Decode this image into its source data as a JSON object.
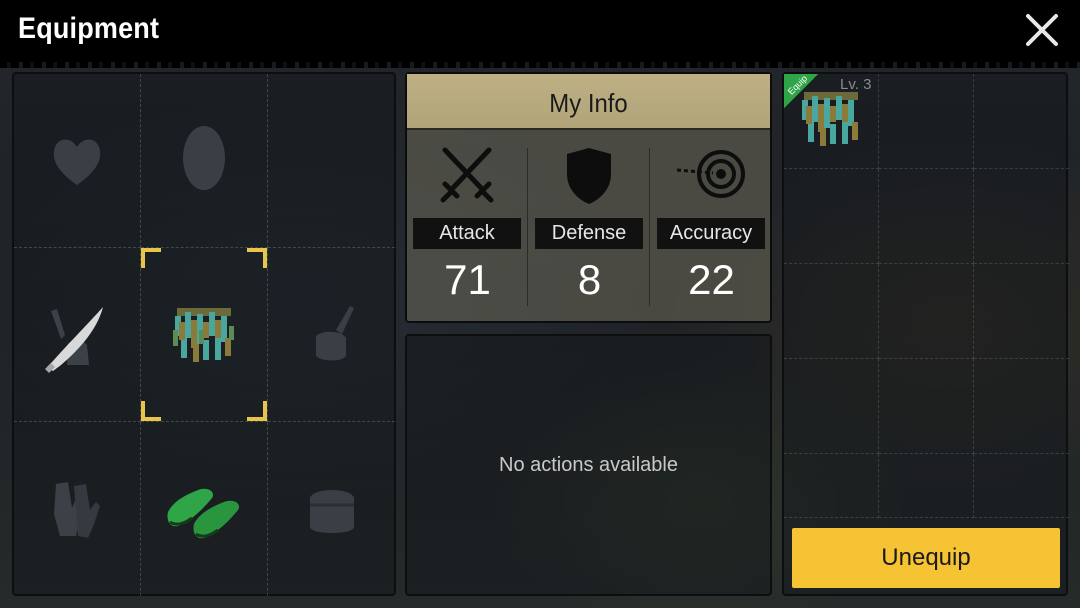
{
  "header": {
    "title": "Equipment",
    "close_icon": "close-icon"
  },
  "equipment_slots": [
    {
      "slot": "top-left",
      "icon": "heart-icon",
      "state": "empty"
    },
    {
      "slot": "top-middle",
      "icon": "head-icon",
      "state": "empty"
    },
    {
      "slot": "top-right",
      "icon": "",
      "state": "empty"
    },
    {
      "slot": "middle-left",
      "icon": "machete-icon",
      "state": "equipped"
    },
    {
      "slot": "middle-center",
      "icon": "ghillie-skirt-icon",
      "state": "selected"
    },
    {
      "slot": "middle-right",
      "icon": "offhand-icon",
      "state": "empty"
    },
    {
      "slot": "bottom-left",
      "icon": "gloves-icon",
      "state": "empty"
    },
    {
      "slot": "bottom-middle",
      "icon": "green-shoes-icon",
      "state": "equipped"
    },
    {
      "slot": "bottom-right",
      "icon": "bag-icon",
      "state": "empty"
    }
  ],
  "info": {
    "title": "My Info",
    "stats": [
      {
        "label": "Attack",
        "value": "71",
        "icon": "crossed-swords-icon"
      },
      {
        "label": "Defense",
        "value": "8",
        "icon": "shield-icon"
      },
      {
        "label": "Accuracy",
        "value": "22",
        "icon": "target-icon"
      }
    ]
  },
  "actions": {
    "message": "No actions available"
  },
  "inventory": {
    "items": [
      {
        "tag": "Equip",
        "level": "Lv. 3",
        "icon": "ghillie-skirt-icon"
      }
    ],
    "unequip_label": "Unequip"
  },
  "colors": {
    "accent_yellow": "#f6c334",
    "header_tan": "#bfb084",
    "equip_green": "#2fa547",
    "bracket_gold": "#e9c44a"
  }
}
